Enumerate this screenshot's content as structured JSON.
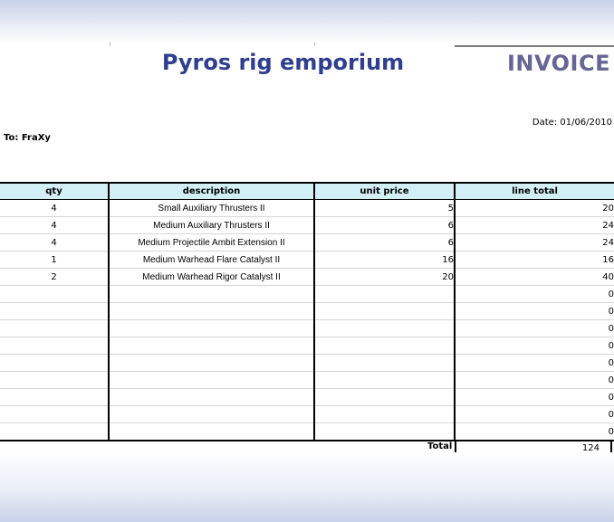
{
  "header": {
    "company": "Pyros rig emporium",
    "doc_title": "INVOICE",
    "date": "Date: 01/06/2010",
    "to": "To: FraXy"
  },
  "columns": [
    "qty",
    "description",
    "unit price",
    "line total"
  ],
  "rows": [
    {
      "qty": "4",
      "description": "Small Auxiliary Thrusters II",
      "unit_price": "5",
      "line_total": "20"
    },
    {
      "qty": "4",
      "description": "Medium Auxiliary Thrusters II",
      "unit_price": "6",
      "line_total": "24"
    },
    {
      "qty": "4",
      "description": "Medium Projectile Ambit Extension II",
      "unit_price": "6",
      "line_total": "24"
    },
    {
      "qty": "1",
      "description": "Medium Warhead Flare Catalyst II",
      "unit_price": "16",
      "line_total": "16"
    },
    {
      "qty": "2",
      "description": "Medium Warhead Rigor Catalyst II",
      "unit_price": "20",
      "line_total": "40"
    },
    {
      "qty": "",
      "description": "",
      "unit_price": "",
      "line_total": "0"
    },
    {
      "qty": "",
      "description": "",
      "unit_price": "",
      "line_total": "0"
    },
    {
      "qty": "",
      "description": "",
      "unit_price": "",
      "line_total": "0"
    },
    {
      "qty": "",
      "description": "",
      "unit_price": "",
      "line_total": "0"
    },
    {
      "qty": "",
      "description": "",
      "unit_price": "",
      "line_total": "0"
    },
    {
      "qty": "",
      "description": "",
      "unit_price": "",
      "line_total": "0"
    },
    {
      "qty": "",
      "description": "",
      "unit_price": "",
      "line_total": "0"
    },
    {
      "qty": "",
      "description": "",
      "unit_price": "",
      "line_total": "0"
    },
    {
      "qty": "",
      "description": "",
      "unit_price": "",
      "line_total": "0"
    }
  ],
  "total": {
    "label": "Total",
    "value": "124"
  },
  "colors": {
    "title": "#2f3f8f",
    "invoice": "#666695",
    "header_fill": "#d2eff5"
  }
}
